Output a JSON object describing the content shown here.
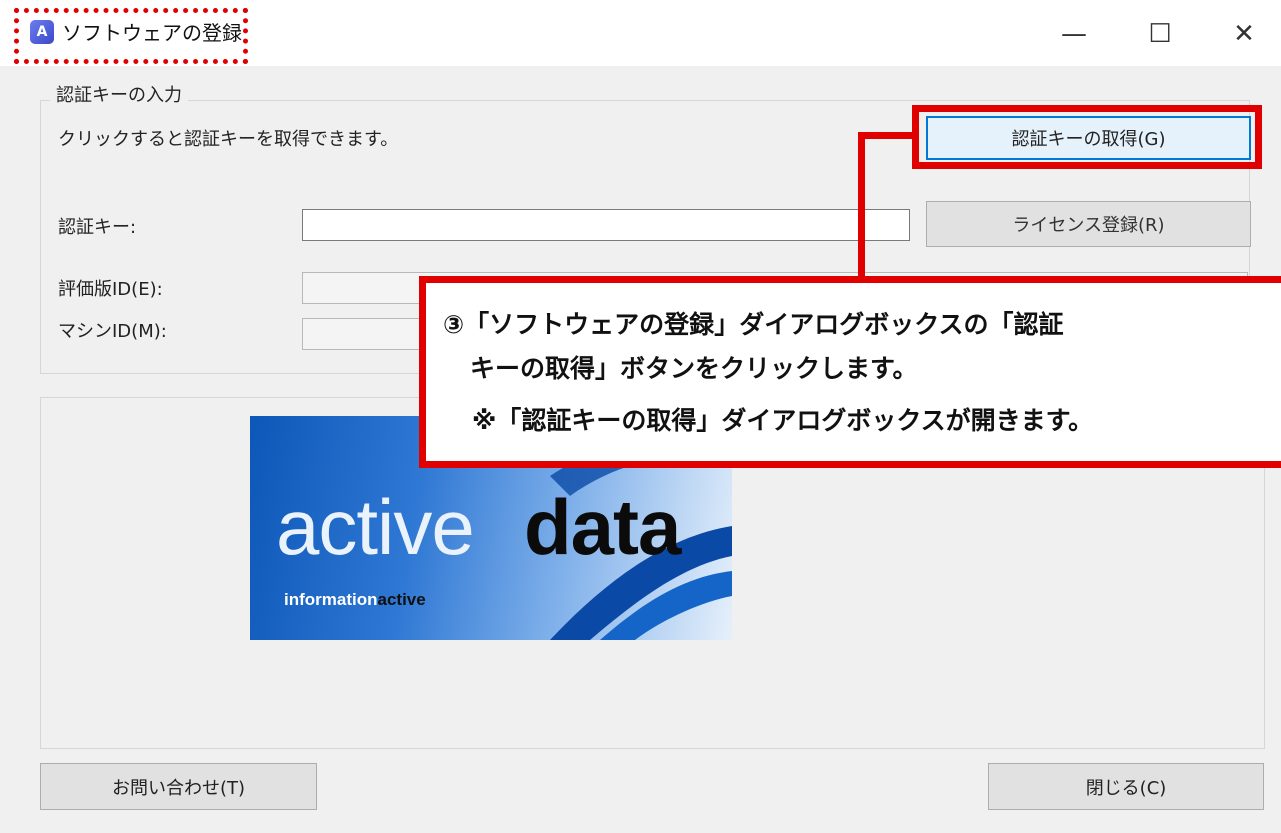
{
  "window": {
    "title": "ソフトウェアの登録",
    "icon_letter": "A",
    "controls": {
      "minimize": "—",
      "maximize": "☐",
      "close": "✕"
    }
  },
  "group": {
    "title": "認証キーの入力",
    "instruction": "クリックすると認証キーを取得できます。",
    "get_key_button": "認証キーの取得(G)",
    "key_label": "認証キー:",
    "key_value": "",
    "license_button": "ライセンス登録(R)",
    "trial_id_label": "評価版ID(E):",
    "machine_id_label": "マシンID(M):"
  },
  "logo": {
    "word_light": "active",
    "word_bold": "data",
    "tagline_light": "information",
    "tagline_bold": "active"
  },
  "footer": {
    "contact_button": "お問い合わせ(T)",
    "close_button": "閉じる(C)"
  },
  "callout": {
    "line1_prefix": "③「",
    "line1_bold1": "ソフトウェアの登録",
    "line1_mid": "」ダイアログボックスの「",
    "line1_bold2": "認証",
    "line2_bold": "キーの取得",
    "line2_rest": "」ボタンをクリックします。",
    "line3_prefix": "※「",
    "line3_bold": "認証キーの取得",
    "line3_rest": "」ダイアログボックスが開きます。"
  },
  "colors": {
    "annotation_red": "#e00000",
    "focus_blue": "#0078d7",
    "dialog_bg": "#f0f0f0"
  }
}
